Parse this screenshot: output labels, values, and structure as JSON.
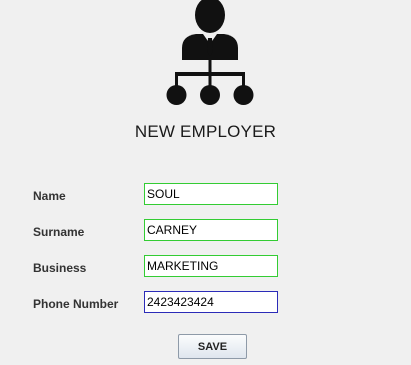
{
  "logo": {
    "icon": "employee-hierarchy-icon",
    "color": "#111111"
  },
  "page_title": "NEW EMPLOYER",
  "form": {
    "fields": [
      {
        "label": "Name",
        "value": "SOUL",
        "state": "valid",
        "border_color": "#33cc33"
      },
      {
        "label": "Surname",
        "value": "CARNEY",
        "state": "valid",
        "border_color": "#33cc33"
      },
      {
        "label": "Business",
        "value": "MARKETING",
        "state": "valid",
        "border_color": "#33cc33"
      },
      {
        "label": "Phone Number",
        "value": "2423423424",
        "state": "focused",
        "border_color": "#2b2bb8"
      }
    ]
  },
  "actions": {
    "save_label": "SAVE"
  },
  "colors": {
    "background": "#f0f0f0",
    "valid_border": "#33cc33",
    "focus_border": "#2b2bb8"
  }
}
